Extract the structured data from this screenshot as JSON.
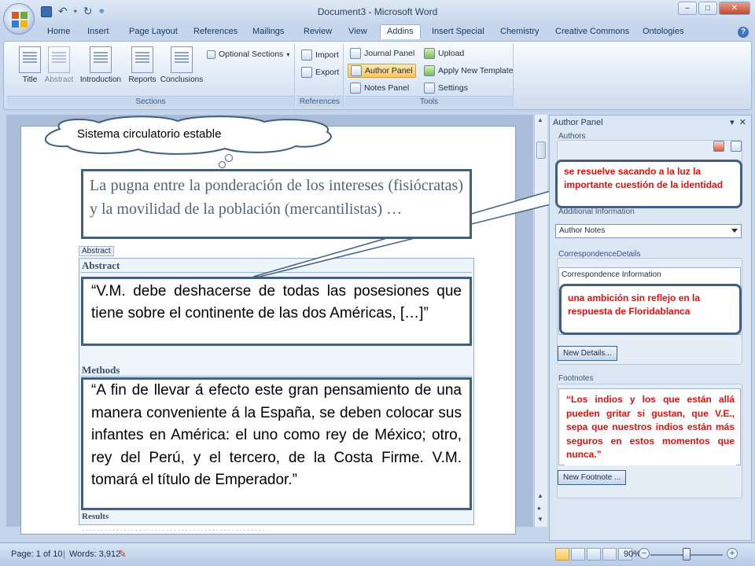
{
  "window": {
    "title": "Document3 - Microsoft Word",
    "controls": [
      "–",
      "□",
      "✕"
    ]
  },
  "tabs": [
    {
      "label": "Home"
    },
    {
      "label": "Insert"
    },
    {
      "label": "Page Layout"
    },
    {
      "label": "References"
    },
    {
      "label": "Mailings"
    },
    {
      "label": "Review"
    },
    {
      "label": "View"
    },
    {
      "label": "Addins",
      "active": true
    },
    {
      "label": "Insert Special"
    },
    {
      "label": "Chemistry"
    },
    {
      "label": "Creative Commons"
    },
    {
      "label": "Ontologies"
    }
  ],
  "ribbon": {
    "sections_group": {
      "label": "Sections",
      "buttons": [
        "Title",
        "Abstract",
        "Introduction",
        "Reports",
        "Conclusions"
      ],
      "optional_sections": "Optional Sections"
    },
    "references_group": {
      "label": "References",
      "import": "Import",
      "export": "Export"
    },
    "tools_group": {
      "label": "Tools",
      "journal_panel": "Journal Panel",
      "author_panel": "Author Panel",
      "notes_panel": "Notes Panel",
      "upload": "Upload",
      "apply_template": "Apply New Template",
      "settings": "Settings"
    }
  },
  "document": {
    "cloud_text": "Sistema circulatorio estable",
    "box1": "La pugna entre la ponderación de los intereses (fisiócratas) y la movilidad de la población (mercantilistas) …",
    "abstract_tag": "Abstract",
    "abstract_heading": "Abstract",
    "box2": "“V.M. debe deshacerse de todas las posesiones que tiene sobre el continente de las dos Américas, […]”",
    "methods_heading": "Methods",
    "box3": "“A fin de llevar á efecto este gran pensamiento de una manera conveniente á la España, se deben colocar sus infantes en América: el uno como rey de México; otro, rey del Perú, y el tercero, de la Costa Firme. V.M. tomará el título de Emperador.”",
    "results_heading": "Results"
  },
  "author_panel": {
    "title": "Author Panel",
    "authors_label": "Authors",
    "callout1": "se resuelve sacando a la luz la importante cuestión de la identidad",
    "additional_info_label": "Additional Information",
    "dropdown_value": "Author Notes",
    "correspondence_label": "CorrespondenceDetails",
    "correspondence_info": "Correspondence Information",
    "callout2": "una ambición sin reflejo en la respuesta de Floridablanca",
    "new_details": "New Details...",
    "footnotes_label": "Footnotes",
    "footnote_text": "“Los indios y los que están allá pueden gritar si gustan, que V.E., sepa que nuestros indios están más seguros en estos momentos que nunca.”",
    "new_footnote": "New Footnote ..."
  },
  "status_bar": {
    "page": "Page: 1 of 10",
    "words": "Words: 3,912",
    "zoom": "90%"
  },
  "colors": {
    "accent_red": "#e0120f",
    "box_border": "#41607f",
    "active_tab_highlight": "#f9c660"
  }
}
